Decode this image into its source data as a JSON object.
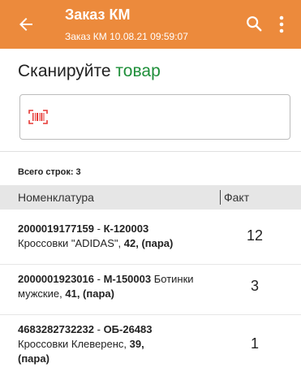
{
  "appbar": {
    "title": "Заказ КМ",
    "subtitle": "Заказ КМ 10.08.21 09:59:07",
    "color": "#ec8a3c"
  },
  "prompt": {
    "text": "Сканируйте",
    "accent": "товар"
  },
  "scan": {
    "placeholder": "",
    "value": ""
  },
  "summary": {
    "rows_count": "Всего строк: 3"
  },
  "table": {
    "headers": {
      "name": "Номенклатура",
      "fact": "Факт"
    },
    "rows": [
      {
        "code": "2000019177159",
        "sep": " - ",
        "article": "К-120003",
        "line2_a": "Кроссовки \"ADIDAS\", ",
        "size": "42",
        "comma": ", ",
        "unit": "(пара)",
        "fact": "12"
      },
      {
        "code": "2000001923016",
        "sep": " - ",
        "article": "М-150003",
        "line1_tail": " Ботинки",
        "line2_a": "мужские, ",
        "size": "41",
        "comma": ", ",
        "unit": "(пара)",
        "fact": "3"
      },
      {
        "code": "4683282732232",
        "sep": " - ",
        "article": "ОБ-26483",
        "line2_a": "Кроссовки Клеверенс, ",
        "size": "39",
        "comma": ",",
        "unit": "(пара)",
        "fact": "1"
      }
    ]
  }
}
